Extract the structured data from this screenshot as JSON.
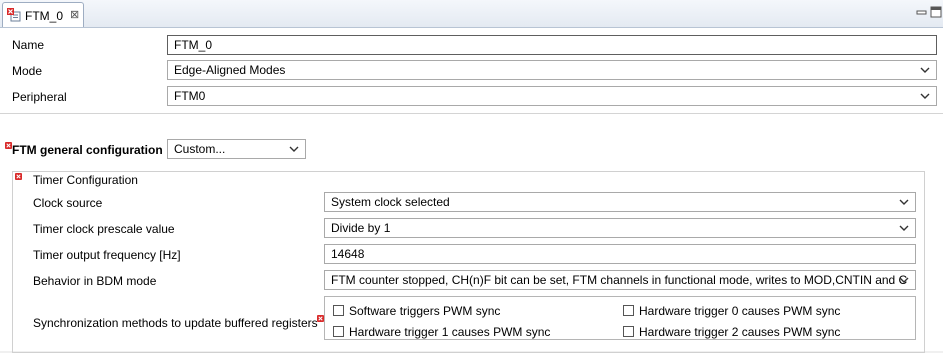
{
  "tab": {
    "title": "FTM_0",
    "close_glyph": "⊠"
  },
  "view": {
    "minimize_icon": "minimize-icon",
    "maximize_icon": "maximize-icon"
  },
  "component": {
    "name_label": "Name",
    "name_value": "FTM_0",
    "mode_label": "Mode",
    "mode_value": "Edge-Aligned Modes",
    "peripheral_label": "Peripheral",
    "peripheral_value": "FTM0"
  },
  "general": {
    "label": "FTM general configuration",
    "value": "Custom..."
  },
  "timer": {
    "group_label": "Timer Configuration",
    "clock_source_label": "Clock source",
    "clock_source_value": "System clock selected",
    "prescale_label": "Timer clock prescale value",
    "prescale_value": "Divide by 1",
    "frequency_label": "Timer output frequency [Hz]",
    "frequency_value": "14648",
    "bdm_label": "Behavior in BDM mode",
    "bdm_value": "FTM counter stopped, CH(n)F bit can be set, FTM channels in functional mode, writes to MOD,CNTIN and C",
    "sync_label": "Synchronization methods to update buffered registers",
    "sync_options": [
      {
        "label": "Software triggers PWM sync",
        "checked": false
      },
      {
        "label": "Hardware trigger 0 causes PWM sync",
        "checked": false
      },
      {
        "label": "Hardware trigger 1 causes PWM sync",
        "checked": false
      },
      {
        "label": "Hardware trigger 2 causes PWM sync",
        "checked": false
      }
    ]
  },
  "colors": {
    "error": "#d92a2a",
    "field_border": "#a9a9a9",
    "tab_border": "#9eadc2"
  }
}
